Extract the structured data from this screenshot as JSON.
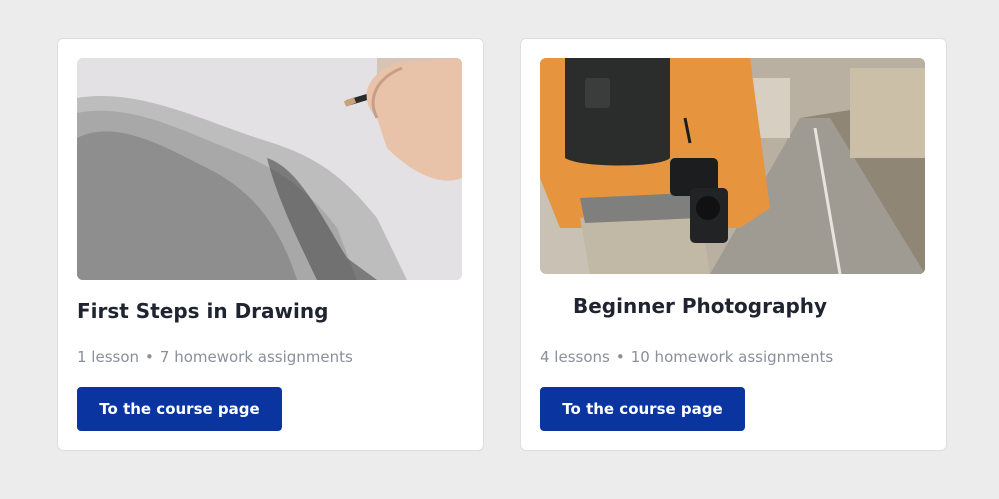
{
  "courses": [
    {
      "title": "First Steps in Drawing",
      "lessons": "1 lesson",
      "separator": "•",
      "homework": "7 homework assignments",
      "button_label": "To the course page",
      "image": "pencil-drawing-image"
    },
    {
      "title": "Beginner Photography",
      "lessons": "4 lessons",
      "separator": "•",
      "homework": "10 homework assignments",
      "button_label": "To the course page",
      "image": "photographer-street-image"
    }
  ],
  "colors": {
    "background": "#ececec",
    "card": "#ffffff",
    "button": "#0a35a0",
    "title": "#1f2430",
    "meta": "#8a8f99"
  }
}
